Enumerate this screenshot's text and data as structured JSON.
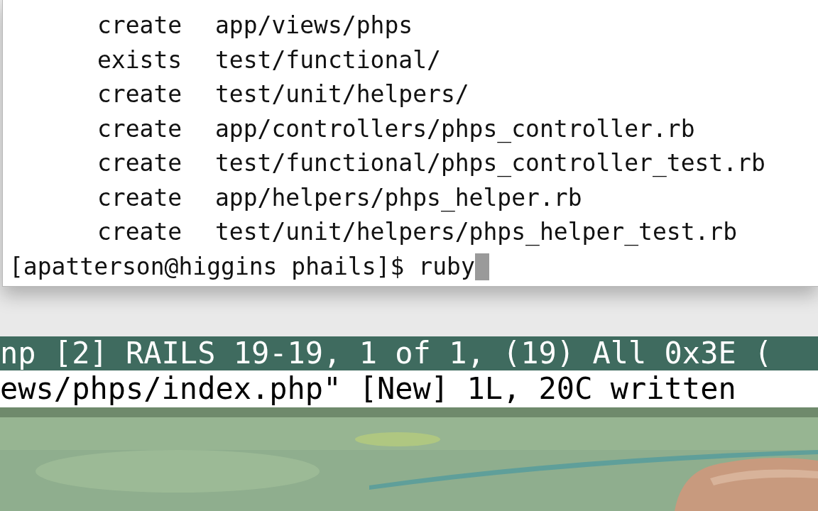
{
  "terminal": {
    "lines": [
      {
        "action": "create",
        "path": "app/views/phps"
      },
      {
        "action": "exists",
        "path": "test/functional/"
      },
      {
        "action": "create",
        "path": "test/unit/helpers/"
      },
      {
        "action": "create",
        "path": "app/controllers/phps_controller.rb"
      },
      {
        "action": "create",
        "path": "test/functional/phps_controller_test.rb"
      },
      {
        "action": "create",
        "path": "app/helpers/phps_helper.rb"
      },
      {
        "action": "create",
        "path": "test/unit/helpers/phps_helper_test.rb"
      }
    ],
    "prompt": "[apatterson@higgins phails]$",
    "command": "ruby"
  },
  "vim": {
    "status_line": "np [2] RAILS 19-19, 1 of 1, (19) All 0x3E (",
    "message": "ews/phps/index.php\" [New] 1L, 20C written"
  }
}
